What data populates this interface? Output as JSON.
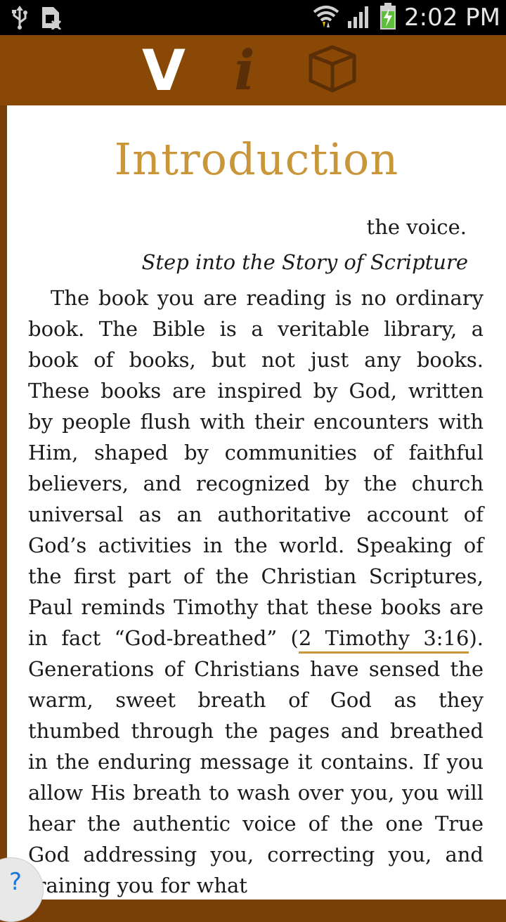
{
  "status_bar": {
    "time": "2:02 PM",
    "icons": [
      "usb-icon",
      "sim-card-icon",
      "wifi-icon",
      "signal-icon",
      "battery-charging-icon"
    ]
  },
  "toolbar": {
    "tools": [
      {
        "name": "verse-tool",
        "glyph": "V",
        "state": "active"
      },
      {
        "name": "info-tool",
        "glyph": "i",
        "state": "inactive"
      },
      {
        "name": "resources-tool",
        "icon": "cube-icon",
        "state": "inactive"
      }
    ],
    "colors": {
      "background": "#8a4806",
      "active": "#ffffff",
      "inactive": "#5a2e06"
    }
  },
  "content": {
    "title": "Introduction",
    "voice_line": "the voice.",
    "subtitle": "Step into the Story of Scripture",
    "body_before": "The book you are reading is no ordinary book. The Bible is a veritable library, a book of books, but not just any books. These books are inspired by God, written by people flush with their encounters with Him, shaped by communities of faithful believers, and recognized by the church universal as an authoritative account of God’s activities in the world. Speaking of the first part of the Christian Scriptures, Paul reminds Timothy that these books are in fact “God-breathed” (",
    "reference": "2 Timothy 3:16",
    "body_after": "). Generations of Christians have sensed the warm, sweet breath of God as they thumbed through the pages and breathed in the enduring message it contains. If you allow His breath to wash over you, you will hear the authentic voice of the one True God addressing you, correcting you, and training you for what",
    "colors": {
      "title": "#c9973a",
      "link_underline": "#c9973a"
    }
  },
  "help": {
    "label": "?"
  }
}
